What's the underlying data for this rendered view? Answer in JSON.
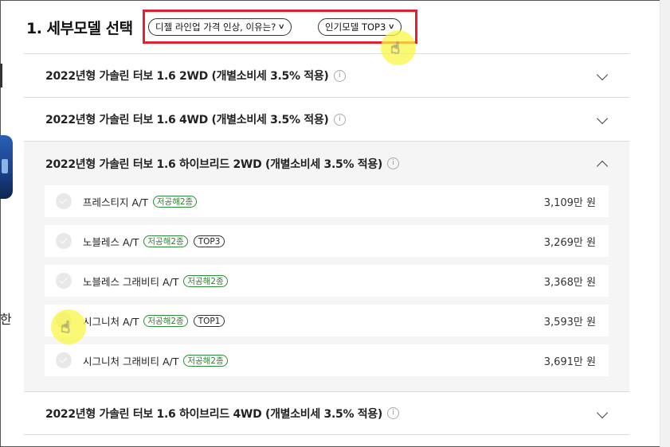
{
  "header": {
    "title": "1. 세부모델 선택",
    "pill_news": "디젤 라인업 가격 인상, 이유는?",
    "pill_top": "인기모델 TOP3"
  },
  "left_fragment": "한",
  "accordion": [
    {
      "label": "2022년형 가솔린 터보 1.6 2WD (개별소비세 3.5% 적용)",
      "expanded": false
    },
    {
      "label": "2022년형 가솔린 터보 1.6 4WD (개별소비세 3.5% 적용)",
      "expanded": false
    },
    {
      "label": "2022년형 가솔린 터보 1.6 하이브리드 2WD (개별소비세 3.5% 적용)",
      "expanded": true
    },
    {
      "label": "2022년형 가솔린 터보 1.6 하이브리드 4WD (개별소비세 3.5% 적용)",
      "expanded": false
    }
  ],
  "trims": [
    {
      "name": "프레스티지 A/T",
      "badges": [
        "저공해2종"
      ],
      "price": "3,109만 원"
    },
    {
      "name": "노블레스 A/T",
      "badges": [
        "저공해2종"
      ],
      "top": "TOP3",
      "price": "3,269만 원"
    },
    {
      "name": "노블레스 그래비티 A/T",
      "badges": [
        "저공해2종"
      ],
      "price": "3,368만 원"
    },
    {
      "name": "시그니처 A/T",
      "badges": [
        "저공해2종"
      ],
      "top": "TOP1",
      "price": "3,593만 원"
    },
    {
      "name": "시그니처 그래비티 A/T",
      "badges": [
        "저공해2종"
      ],
      "price": "3,691만 원"
    }
  ],
  "icons": {
    "info": "info-icon",
    "chevron": "chevron-icon",
    "check": "check-icon",
    "cursor": "hand-cursor-icon"
  },
  "colors": {
    "highlight": "#e5202e",
    "eco_badge": "#2e7d32",
    "cursor_halo": "#faf546"
  }
}
